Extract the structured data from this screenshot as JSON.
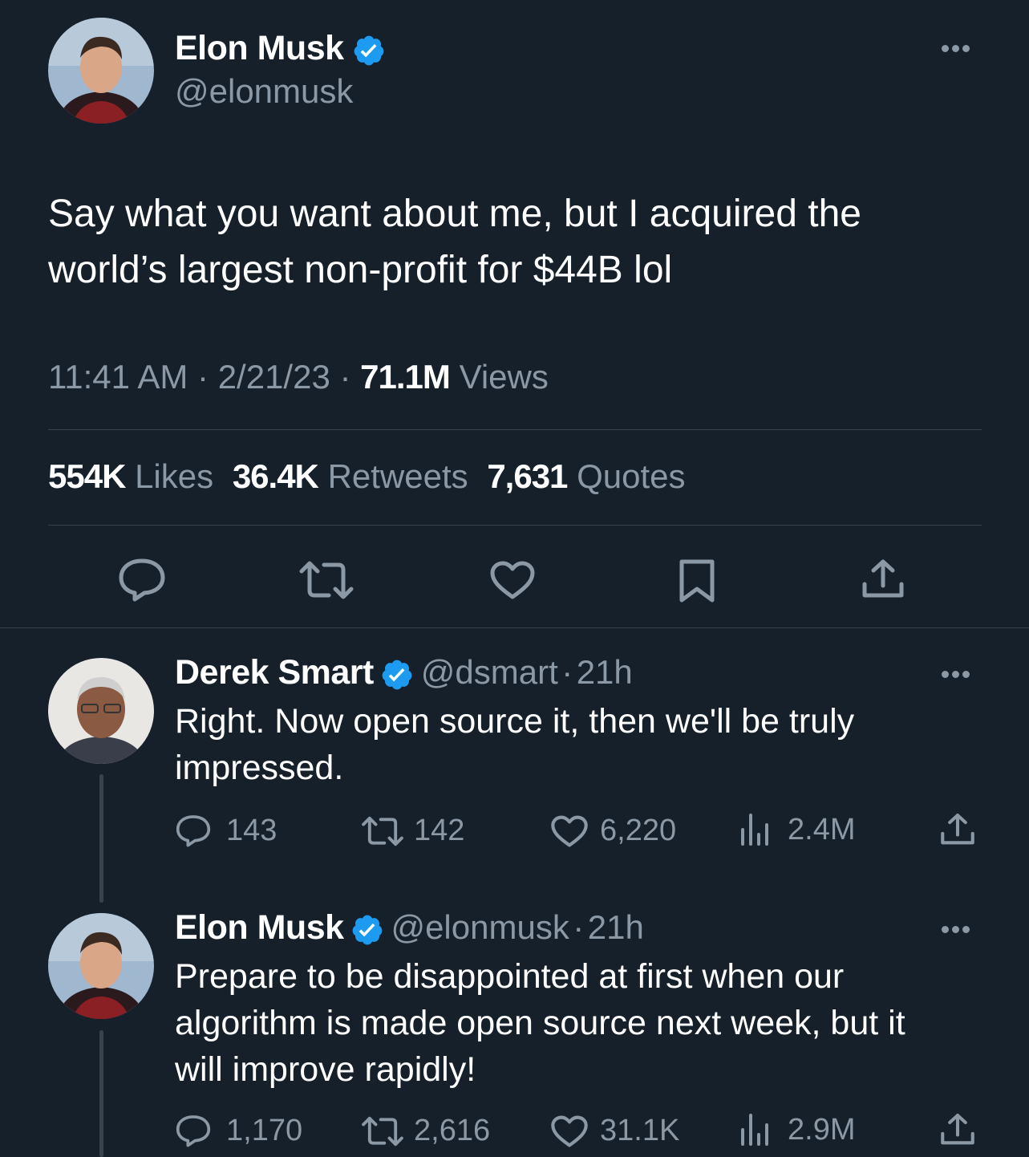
{
  "main_tweet": {
    "author_name": "Elon Musk",
    "author_handle": "@elonmusk",
    "text_line1": "Say what you want about me, but I acquired the",
    "text_line2": "world’s largest non-profit for $44B lol",
    "time": "11:41 AM",
    "sep1": "·",
    "date": "2/21/23",
    "sep2": "·",
    "views_count": "71.1M",
    "views_label": "Views",
    "likes_count": "554K",
    "likes_label": "Likes",
    "retweets_count": "36.4K",
    "retweets_label": "Retweets",
    "quotes_count": "7,631",
    "quotes_label": "Quotes",
    "actions": [
      "reply-icon",
      "retweet-icon",
      "like-icon",
      "bookmark-icon",
      "share-icon"
    ]
  },
  "replies": [
    {
      "author_name": "Derek Smart",
      "author_handle": "@dsmart",
      "sep": "·",
      "age": "21h",
      "text_line1": "Right. Now open source it, then we'll be truly",
      "text_line2": "impressed.",
      "replies": "143",
      "retweets": "142",
      "likes": "6,220",
      "views": "2.4M"
    },
    {
      "author_name": "Elon Musk",
      "author_handle": "@elonmusk",
      "sep": "·",
      "age": "21h",
      "text_line1": "Prepare to be disappointed at first when our",
      "text_line2": "algorithm is made open source next week, but it",
      "text_line3": "will improve rapidly!",
      "replies": "1,170",
      "retweets": "2,616",
      "likes": "31.1K",
      "views": "2.9M"
    }
  ],
  "colors": {
    "background": "#15202b",
    "text": "#ffffff",
    "muted": "#8b98a5",
    "divider": "#38444d",
    "verified": "#1d9bf0"
  }
}
